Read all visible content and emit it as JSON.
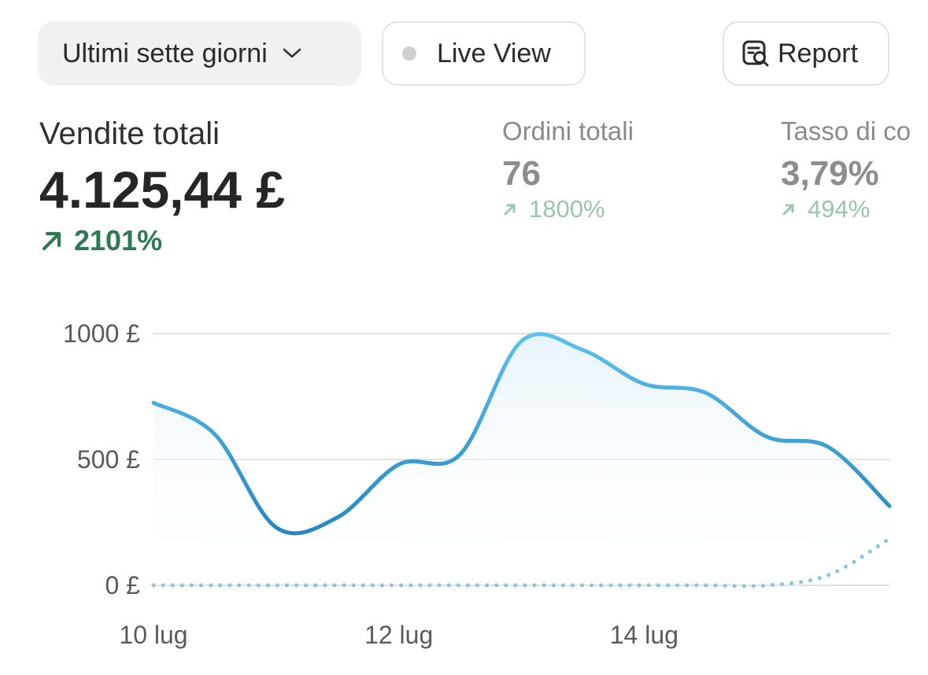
{
  "toolbar": {
    "range_label": "Ultimi sette giorni",
    "live_label": "Live View",
    "report_label": "Report"
  },
  "metrics": {
    "primary": {
      "label": "Vendite totali",
      "value": "4.125,44 £",
      "delta": "2101%"
    },
    "orders": {
      "label": "Ordini totali",
      "value": "76",
      "delta": "1800%"
    },
    "conversion": {
      "label": "Tasso di co",
      "value": "3,79%",
      "delta": "494%"
    }
  },
  "colors": {
    "accent": "#2f9fd6",
    "accent_light": "#5cc1ec",
    "positive": "#2c7a52",
    "positive_muted": "#98c7ab",
    "grid": "#e2e2e2"
  },
  "chart_data": {
    "type": "line",
    "x_tick_labels": [
      "10 lug",
      "12 lug",
      "14 lug"
    ],
    "y_tick_labels": [
      "1000 £",
      "500 £",
      "0 £"
    ],
    "y_ticks": [
      1000,
      500,
      0
    ],
    "ylim": [
      0,
      1000
    ],
    "x": [
      0,
      0.5,
      1,
      1.5,
      2,
      2.5,
      3,
      3.5,
      4,
      4.5,
      5,
      5.5,
      6
    ],
    "series": [
      {
        "style": "solid",
        "values": [
          725,
          600,
          230,
          270,
          480,
          520,
          970,
          935,
          800,
          765,
          590,
          550,
          315
        ]
      },
      {
        "style": "dotted",
        "values": [
          0,
          0,
          0,
          0,
          0,
          0,
          0,
          0,
          0,
          0,
          0,
          40,
          185
        ]
      }
    ],
    "grid": true,
    "legend": "none"
  }
}
